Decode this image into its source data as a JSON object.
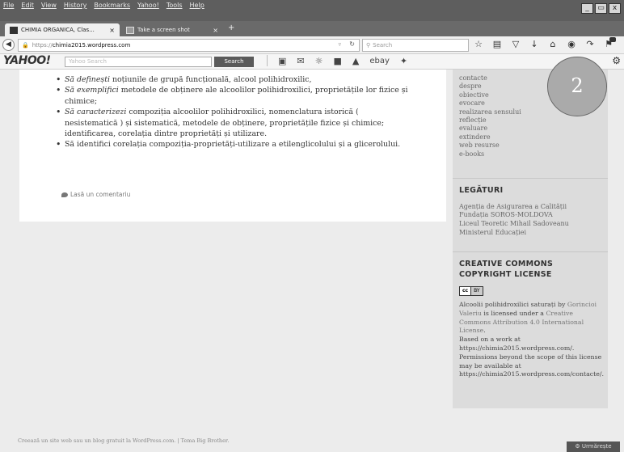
{
  "browser": {
    "menu": [
      "File",
      "Edit",
      "View",
      "History",
      "Bookmarks",
      "Yahoo!",
      "Tools",
      "Help"
    ],
    "window_controls": [
      "_",
      "▭",
      "x"
    ],
    "tabs": [
      {
        "title": "CHIMIA ORGANICA, Clas...",
        "close": "×"
      },
      {
        "title": "Take a screen shot",
        "close": "×"
      }
    ],
    "new_tab": "+",
    "url_protocol": "https://",
    "url_host": "chimia2015.wordpress.com",
    "search_placeholder": "Search",
    "nav_icon_names": [
      "star-icon",
      "clipboard-icon",
      "pocket-icon",
      "download-icon",
      "home-icon",
      "chat-icon",
      "share-icon",
      "notifications-icon",
      "menu-icon"
    ]
  },
  "yahoo_toolbar": {
    "logo": "YAHOO!",
    "search_placeholder": "Yahoo Search",
    "search_button": "Search",
    "ebay": "ebay"
  },
  "article": {
    "objectives": [
      {
        "verb": "Să definești",
        "text": " noțiunile de grupă funcțională, alcool polihidroxilic,"
      },
      {
        "verb": "Să exemplifici",
        "text": " metodele de obținere ale  alcoolilor polihidroxilici, proprietățile lor fizice și chimice;"
      },
      {
        "verb": "Să caracterizezi",
        "text": " compoziția alcoolilor polihidroxilici, nomenclatura istorică ( nesistematică )  și sistematică, metodele de obținere, proprietățile fizice și chimice; identificarea, corelația dintre proprietăți și utilizare."
      },
      {
        "verb": "",
        "text": "Să identifici corelația compoziția-proprietăți-utilizare a etilenglicolului și a glicerolului."
      }
    ],
    "comment_link": "Lasă un comentariu"
  },
  "sidebar": {
    "nav_links": [
      "contacte",
      "despre",
      "obiective",
      "evocare",
      "realizarea sensului",
      "reflecție",
      "evaluare",
      "extindere",
      "web resurse",
      "e-books"
    ],
    "links_title": "LEGĂTURI",
    "links": [
      "Agenția de Asigurarea a Calității",
      "Fundația SOROS-MOLDOVA",
      "Liceul Teoretic Mihail Sadoveanu",
      "Ministerul Educației"
    ],
    "license_title": "CREATIVE COMMONS COPYRIGHT LICENSE",
    "cc_badge": {
      "cc": "cc",
      "by": "BY"
    },
    "license_work": "Alcoolii polihidroxilici saturați",
    "license_by": " by ",
    "license_author": "Gorincioi Valeriu",
    "license_is": " is licensed under a ",
    "license_name": "Creative Commons Attribution 4.0 International License",
    "license_period": ".",
    "based_on": "Based on a work at https://chimia2015.wordpress.com/.",
    "permissions": "Permissions beyond the scope of this license may be available at https://chimia2015.wordpress.com/contacte/."
  },
  "slide_number": "2",
  "footer": {
    "credit": "Creează un site web sau un blog gratuit la WordPress.com. | Tema Big Brother.",
    "follow": "Urmărește"
  },
  "colors": {
    "menubar": "#5e5e5e",
    "page_background": "#ececec",
    "sidebar_background": "#dcdcdc",
    "slide_badge": "#aaaaaa"
  }
}
